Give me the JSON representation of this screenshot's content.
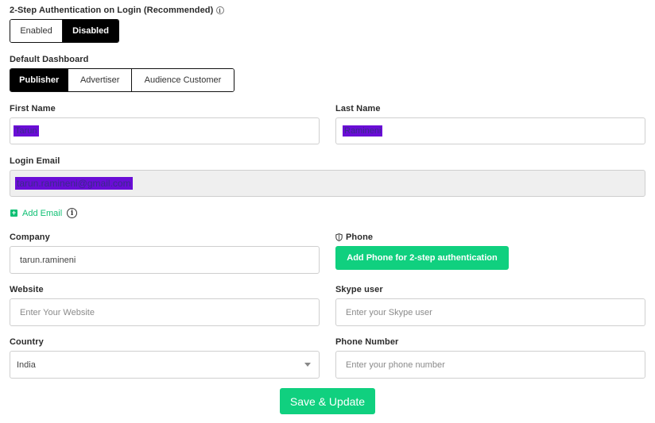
{
  "two_step": {
    "label": "2-Step Authentication on Login (Recommended)",
    "options": [
      "Enabled",
      "Disabled"
    ],
    "selected": "Disabled"
  },
  "dashboard": {
    "label": "Default Dashboard",
    "options": [
      "Publisher",
      "Advertiser",
      "Audience Customer"
    ],
    "selected": "Publisher"
  },
  "first_name": {
    "label": "First Name",
    "value": "Tarun"
  },
  "last_name": {
    "label": "Last Name",
    "value": "Ramineni"
  },
  "login_email": {
    "label": "Login Email",
    "value": "tarun.ramineni@gmail.com"
  },
  "add_email": {
    "label": "Add Email"
  },
  "company": {
    "label": "Company",
    "value": "tarun.ramineni"
  },
  "phone": {
    "label": "Phone",
    "button": "Add Phone for 2-step authentication"
  },
  "website": {
    "label": "Website",
    "placeholder": "Enter Your Website"
  },
  "skype": {
    "label": "Skype user",
    "placeholder": "Enter your Skype user"
  },
  "country": {
    "label": "Country",
    "value": "India"
  },
  "phone_number": {
    "label": "Phone Number",
    "placeholder": "Enter your phone number"
  },
  "save_button": "Save & Update",
  "colors": {
    "accent": "#10d07f",
    "highlight": "#6a0dd6"
  }
}
